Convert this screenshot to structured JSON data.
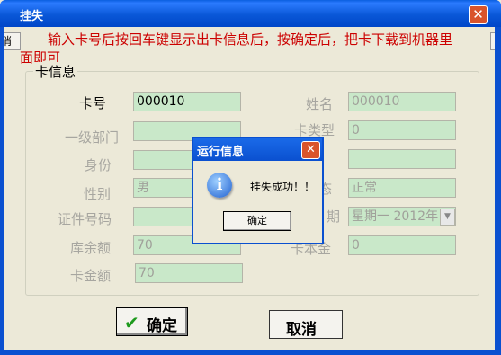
{
  "window": {
    "title": "挂失",
    "close_symbol": "✕"
  },
  "background_fragment": "消费",
  "instruction": {
    "line1": "输入卡号后按回车键显示出卡信息后，按确定后，把卡下载到机器里",
    "line2": "面即可"
  },
  "card_info": {
    "group_title": "卡信息",
    "left_fields": [
      {
        "label": "卡号",
        "value": "000010"
      },
      {
        "label": "一级部门",
        "value": ""
      },
      {
        "label": "身份",
        "value": ""
      },
      {
        "label": "性别",
        "value": "男"
      },
      {
        "label": "证件号码",
        "value": ""
      },
      {
        "label": "库余额",
        "value": "70"
      },
      {
        "label": "卡金额",
        "value": "70"
      }
    ],
    "right_fields": [
      {
        "label": "姓名",
        "value": "000010"
      },
      {
        "label": "卡类型",
        "value": "0"
      },
      {
        "label": "",
        "value": ""
      },
      {
        "label": "态",
        "value": "正常"
      },
      {
        "label": "期",
        "value": "星期一  2012年"
      },
      {
        "label": "卡本金",
        "value": "0"
      }
    ]
  },
  "buttons": {
    "ok": "确定",
    "cancel": "取消"
  },
  "dialog": {
    "title": "运行信息",
    "close_symbol": "✕",
    "message": "挂失成功！！",
    "ok": "确定",
    "icon": "info-icon"
  },
  "colors": {
    "titlebar": "#0a58d8",
    "field_bg": "#c9e8c9",
    "instruction": "#cc0000",
    "ok_check": "#1e9a1e"
  }
}
